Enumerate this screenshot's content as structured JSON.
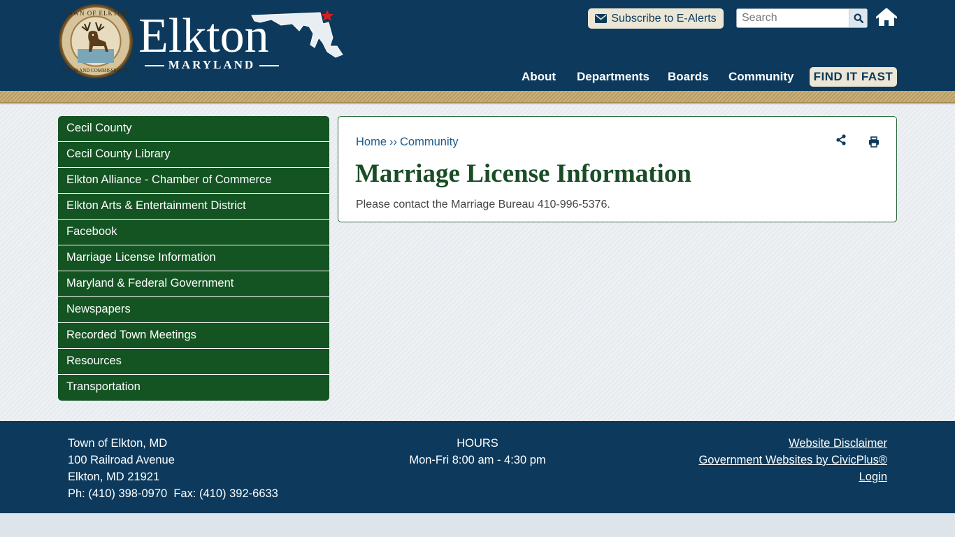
{
  "header": {
    "brand_name": "Elkton",
    "brand_sub": "MARYLAND",
    "seal_text_top": "TOWN OF ELKTON",
    "seal_text_bottom": "MAYOR AND COMMISSIONERS",
    "subscribe_label": "Subscribe to E-Alerts",
    "search_placeholder": "Search",
    "nav": [
      "About",
      "Departments",
      "Boards",
      "Community"
    ],
    "find_it_fast": "FIND IT FAST"
  },
  "sidebar": {
    "items": [
      "Cecil County",
      "Cecil County Library",
      "Elkton Alliance - Chamber of Commerce",
      "Elkton Arts & Entertainment District",
      "Facebook",
      "Marriage License Information",
      "Maryland & Federal Government",
      "Newspapers",
      "Recorded Town Meetings",
      "Resources",
      "Transportation"
    ]
  },
  "main": {
    "breadcrumb": [
      "Home",
      "Community"
    ],
    "breadcrumb_sep": "››",
    "title": "Marriage License Information",
    "body": "Please contact the Marriage Bureau 410-996-5376."
  },
  "footer": {
    "address": [
      "Town of Elkton, MD",
      "100 Railroad Avenue",
      "Elkton, MD 21921",
      "Ph: (410) 398-0970  Fax: (410) 392-6633"
    ],
    "hours_title": "HOURS",
    "hours": "Mon-Fri 8:00 am - 4:30 pm",
    "links": [
      "Website Disclaimer",
      "Government Websites by CivicPlus®",
      "Login"
    ]
  },
  "colors": {
    "header_bg": "#0d3a5c",
    "sidebar_bg": "#145423",
    "title_color": "#1a4d26",
    "link_color": "#1a5a8a",
    "button_bg": "#ebe6d6"
  }
}
